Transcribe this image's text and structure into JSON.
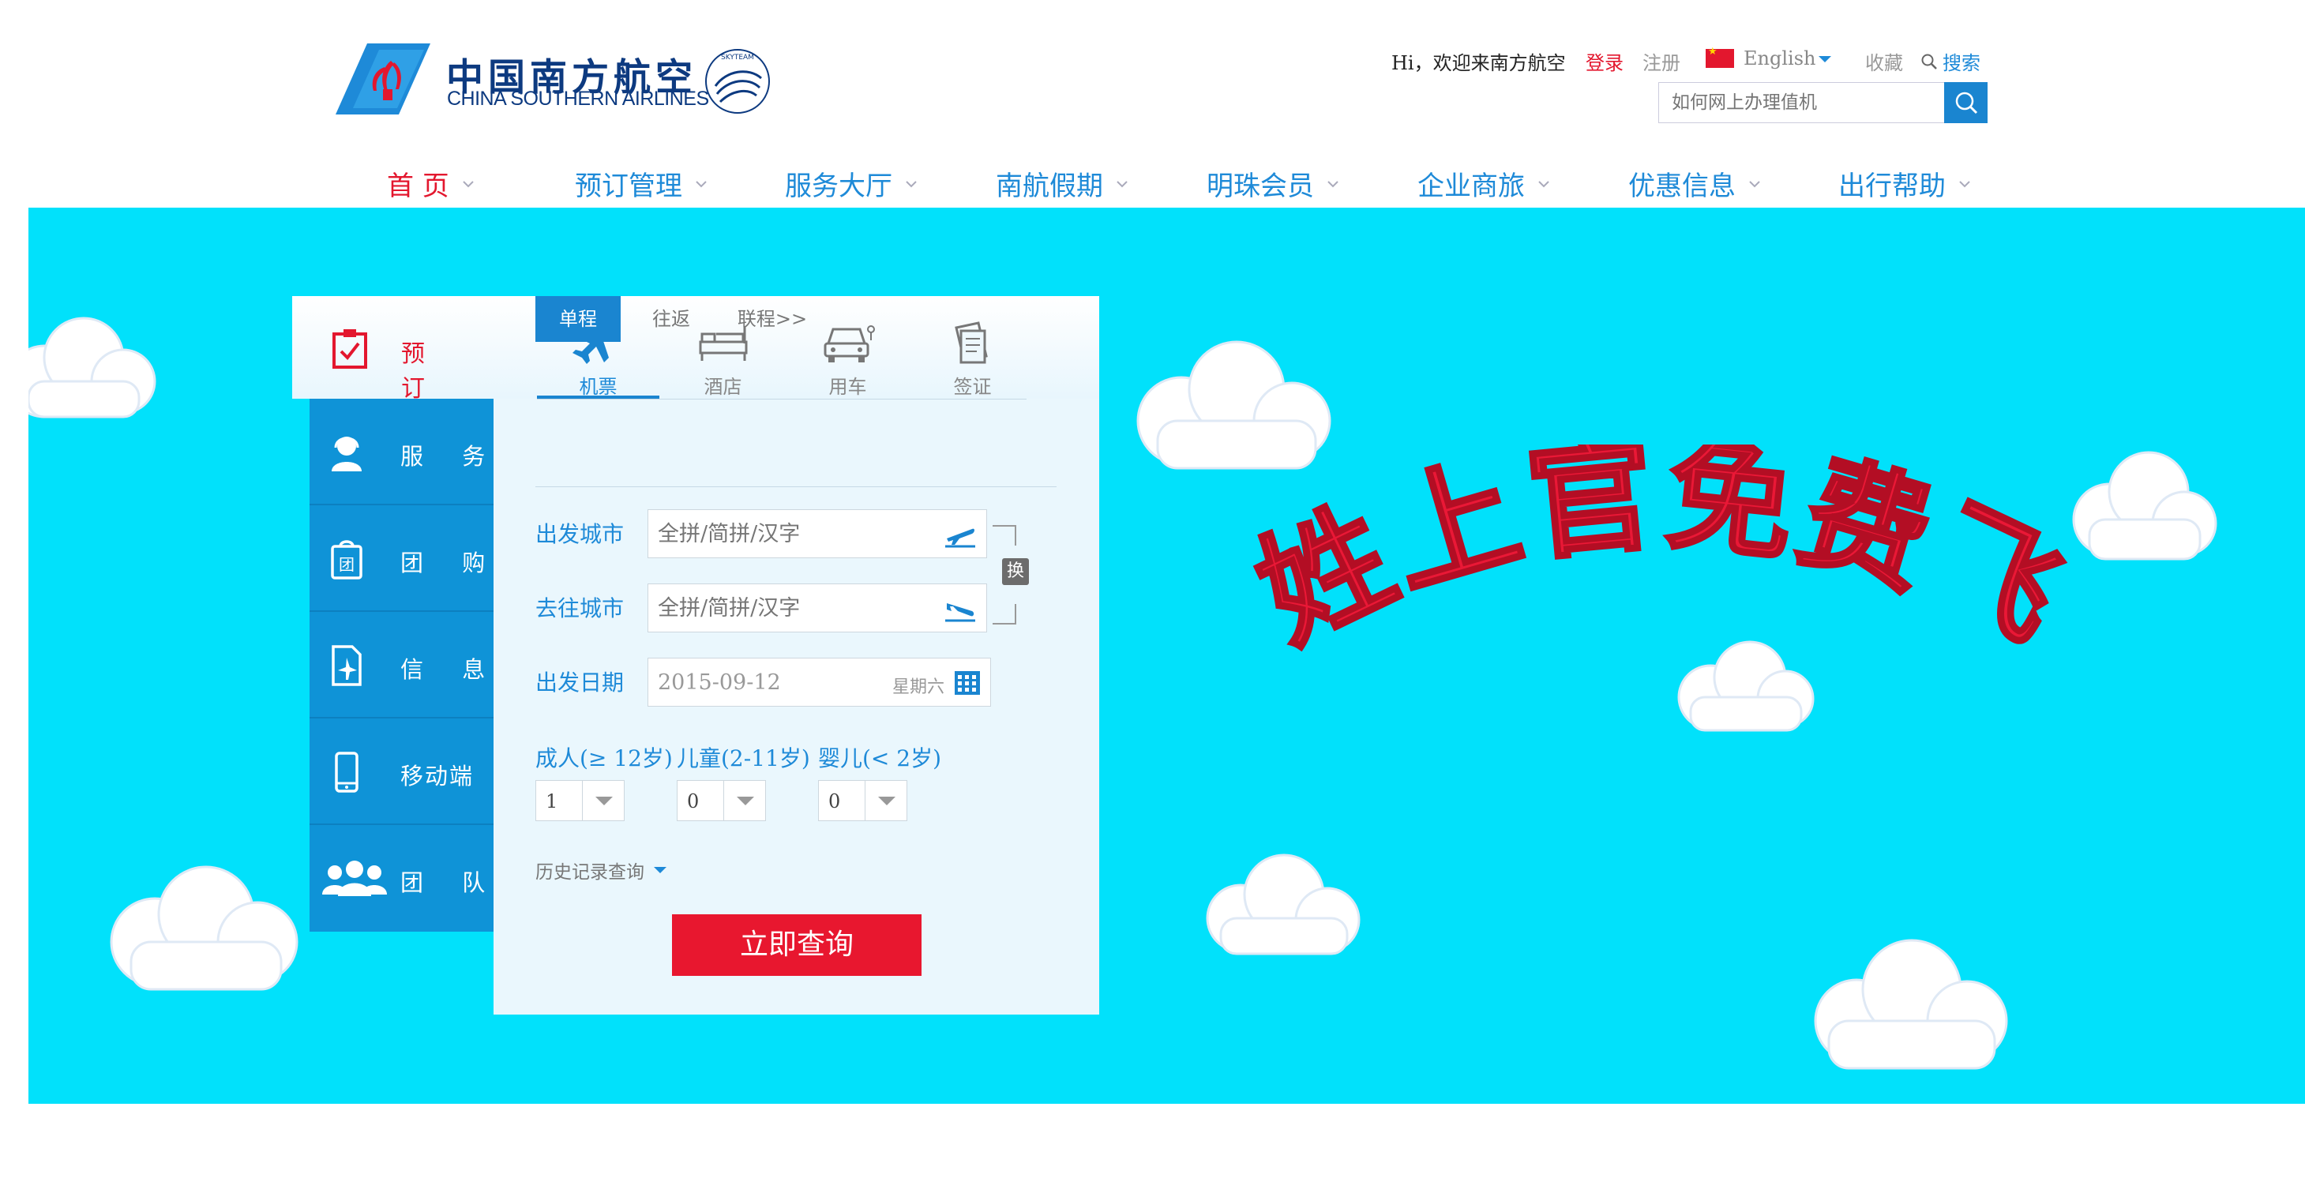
{
  "header": {
    "logo": {
      "zh": "中国南方航空",
      "en": "CHINA SOUTHERN AIRLINES",
      "alliance": "SKYTEAM"
    },
    "greeting": "Hi，欢迎来南方航空",
    "login": "登录",
    "register": "注册",
    "language": "English",
    "favorite": "收藏",
    "search_link": "搜索",
    "search_placeholder": "如何网上办理值机"
  },
  "nav": [
    {
      "label": "首 页"
    },
    {
      "label": "预订管理"
    },
    {
      "label": "服务大厅"
    },
    {
      "label": "南航假期"
    },
    {
      "label": "明珠会员"
    },
    {
      "label": "企业商旅"
    },
    {
      "label": "优惠信息"
    },
    {
      "label": "出行帮助"
    }
  ],
  "banner": {
    "slogan": "姓上官免费飞"
  },
  "booking": {
    "side": {
      "book": "预 订",
      "items": [
        {
          "label": "服 务",
          "icon": "service-icon"
        },
        {
          "label": "团 购",
          "icon": "group-buy-icon"
        },
        {
          "label": "信 息",
          "icon": "flight-info-icon"
        },
        {
          "label": "移动端",
          "icon": "mobile-icon"
        },
        {
          "label": "团 队",
          "icon": "team-icon"
        }
      ]
    },
    "product_tabs": [
      {
        "label": "机票",
        "icon": "plane-icon"
      },
      {
        "label": "酒店",
        "icon": "bed-icon"
      },
      {
        "label": "用车",
        "icon": "car-icon"
      },
      {
        "label": "签证",
        "icon": "visa-icon"
      }
    ],
    "trip_tabs": [
      "单程",
      "往返",
      "联程>>"
    ],
    "depart_label": "出发城市",
    "arrive_label": "去往城市",
    "date_label": "出发日期",
    "city_placeholder": "全拼/简拼/汉字",
    "date_value": "2015-09-12",
    "weekday": "星期六",
    "swap": "换",
    "adult_label": "成人(≥ 12岁)",
    "child_label": "儿童(2-11岁)",
    "infant_label": "婴儿(< 2岁)",
    "adult_value": "1",
    "child_value": "0",
    "infant_value": "0",
    "history": "历史记录查询",
    "query_button": "立即查询"
  },
  "colors": {
    "brand_blue": "#1a85d0",
    "accent_red": "#e3172e",
    "banner_bg": "#01e1fb"
  }
}
